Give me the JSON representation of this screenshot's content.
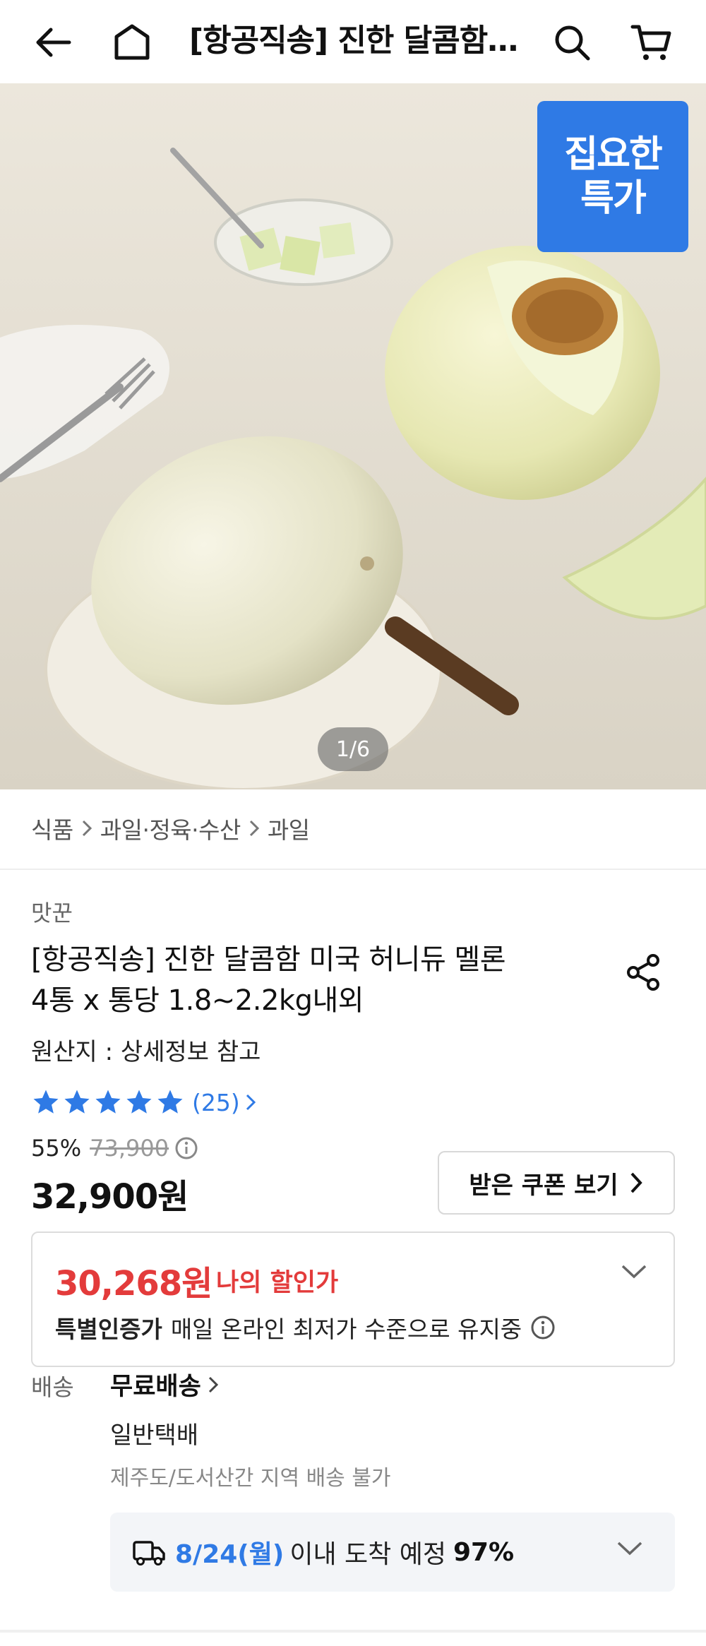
{
  "header": {
    "title": "[항공직송] 진한 달콤함 미국 허니듀 멜론 4통 x 통당 1.8~2.2kg내외",
    "icons": [
      "back-arrow-icon",
      "home-icon",
      "search-icon",
      "cart-icon"
    ]
  },
  "hero": {
    "badge_line1": "집요한",
    "badge_line2": "특가",
    "pager": "1/6"
  },
  "breadcrumb": [
    "식품",
    "과일·정육·수산",
    "과일"
  ],
  "product": {
    "brand": "맛꾼",
    "title_line1": "[항공직송] 진한 달콤함 미국 허니듀 멜론",
    "title_line2": "4통 x 통당 1.8~2.2kg내외",
    "origin": "원산지 : 상세정보 참고",
    "rating_stars": 5,
    "rating_count": "(25)",
    "discount_rate": "55%",
    "original_price": "73,900",
    "price": "32,900원",
    "coupon_button": "받은 쿠폰 보기"
  },
  "my_price": {
    "price": "30,268원",
    "label": "나의 할인가",
    "cert_title": "특별인증가",
    "cert_text": "매일 온라인 최저가 수준으로 유지중"
  },
  "shipping": {
    "label": "배송",
    "free": "무료배송",
    "type": "일반택배",
    "note": "제주도/도서산간 지역 배송 불가",
    "arrival_date": "8/24(월)",
    "arrival_text": "이내 도착 예정",
    "arrival_pct": "97%"
  },
  "colors": {
    "accent_blue": "#2f7ae5",
    "price_red": "#e33b3b"
  }
}
